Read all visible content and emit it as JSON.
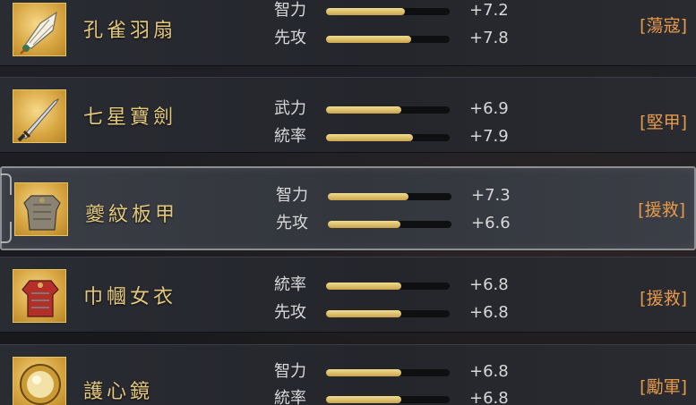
{
  "items": [
    {
      "name": "孔雀羽扇",
      "icon": "peacock-feather-fan-icon",
      "tag": "[蕩寇]",
      "stats": [
        {
          "label": "智力",
          "value": "+7.2",
          "fill": 0.64
        },
        {
          "label": "先攻",
          "value": "+7.8",
          "fill": 0.69
        }
      ]
    },
    {
      "name": "七星寶劍",
      "icon": "seven-star-sword-icon",
      "tag": "[堅甲]",
      "stats": [
        {
          "label": "武力",
          "value": "+6.9",
          "fill": 0.61
        },
        {
          "label": "統率",
          "value": "+7.9",
          "fill": 0.7
        }
      ]
    },
    {
      "name": "夔紋板甲",
      "icon": "plate-armor-icon",
      "tag": "[援救]",
      "stats": [
        {
          "label": "智力",
          "value": "+7.3",
          "fill": 0.65
        },
        {
          "label": "先攻",
          "value": "+6.6",
          "fill": 0.59
        }
      ]
    },
    {
      "name": "巾幗女衣",
      "icon": "female-armor-robe-icon",
      "tag": "[援救]",
      "stats": [
        {
          "label": "統率",
          "value": "+6.8",
          "fill": 0.61
        },
        {
          "label": "先攻",
          "value": "+6.8",
          "fill": 0.61
        }
      ]
    },
    {
      "name": "護心鏡",
      "icon": "heart-protector-mirror-icon",
      "tag": "[勵軍]",
      "stats": [
        {
          "label": "智力",
          "value": "+6.8",
          "fill": 0.61
        },
        {
          "label": "統率",
          "value": "+6.8",
          "fill": 0.61
        }
      ]
    }
  ],
  "selected_index": 2
}
